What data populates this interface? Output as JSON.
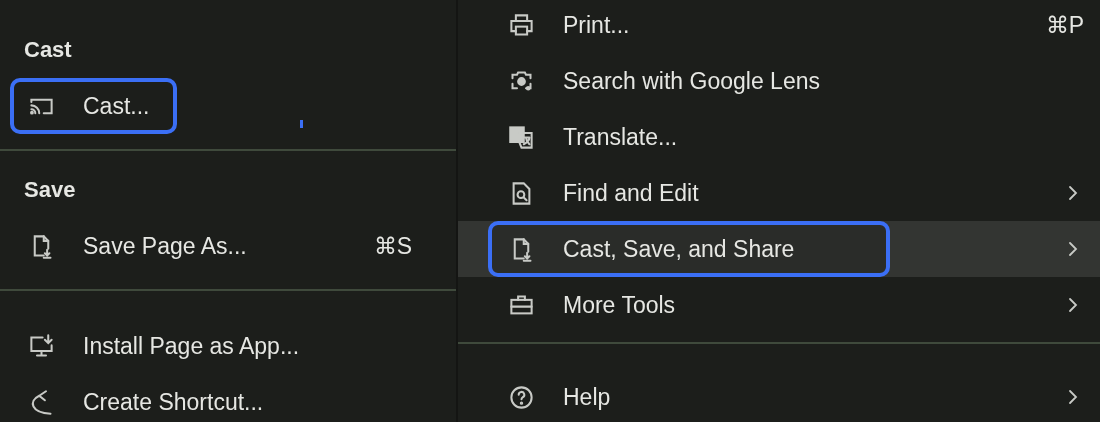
{
  "left_menu": {
    "sections": [
      {
        "heading": "Cast",
        "items": [
          {
            "label": "Cast...",
            "outlined": true
          }
        ]
      },
      {
        "heading": "Save",
        "items": [
          {
            "label": "Save Page As...",
            "shortcut": "⌘S",
            "outlined": false
          }
        ]
      },
      {
        "items": [
          {
            "label": "Install Page as App...",
            "outlined": false
          },
          {
            "label": "Create Shortcut...",
            "outlined": false
          }
        ]
      }
    ]
  },
  "right_menu": {
    "groups": [
      {
        "items": [
          {
            "label": "Print...",
            "shortcut": "⌘P",
            "submenu": false,
            "selected": false,
            "outlined": false
          },
          {
            "label": "Search with Google Lens",
            "submenu": false,
            "selected": false,
            "outlined": false
          },
          {
            "label": "Translate...",
            "submenu": false,
            "selected": false,
            "outlined": false
          },
          {
            "label": "Find and Edit",
            "submenu": true,
            "selected": false,
            "outlined": false
          },
          {
            "label": "Cast, Save, and Share",
            "submenu": true,
            "selected": true,
            "outlined": true
          },
          {
            "label": "More Tools",
            "submenu": true,
            "selected": false,
            "outlined": false
          }
        ]
      },
      {
        "items": [
          {
            "label": "Help",
            "submenu": true,
            "selected": false,
            "outlined": false
          }
        ]
      }
    ]
  }
}
